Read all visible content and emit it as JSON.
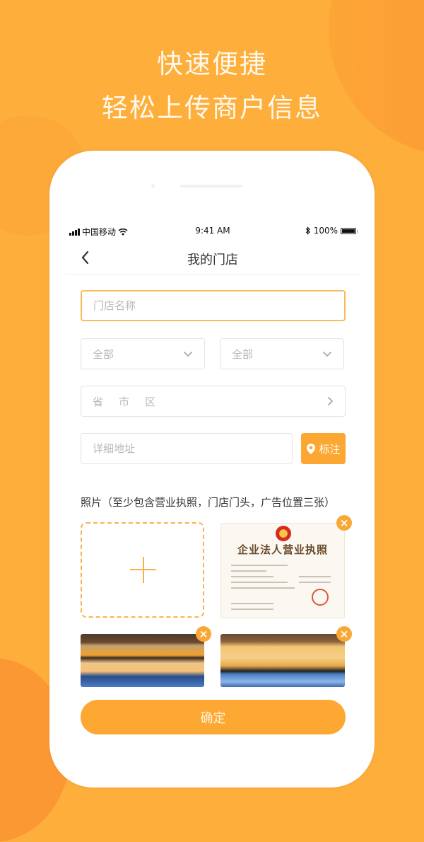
{
  "promo": {
    "headline_1": "快速便捷",
    "headline_2": "轻松上传商户信息"
  },
  "status_bar": {
    "carrier": "中国移动",
    "time": "9:41 AM",
    "battery": "100%",
    "battery_level": 1.0
  },
  "nav": {
    "title": "我的门店",
    "back_icon": "chevron-left-icon"
  },
  "form": {
    "store_name_placeholder": "门店名称",
    "store_name_value": "",
    "select_1": {
      "value": "全部",
      "icon": "chevron-down-icon"
    },
    "select_2": {
      "value": "全部",
      "icon": "chevron-down-icon"
    },
    "region": {
      "province": "省",
      "city": "市",
      "district": "区",
      "icon": "chevron-right-icon"
    },
    "address_placeholder": "详细地址",
    "address_value": "",
    "mark_button": {
      "label": "标注",
      "icon": "location-pin-icon"
    }
  },
  "photos": {
    "label": "照片（至少包含营业执照，门店门头，广告位置三张）",
    "add_icon": "plus-icon",
    "items": [
      {
        "kind": "business-license",
        "title": "企业法人营业执照",
        "remove_icon": "close-icon"
      },
      {
        "kind": "storefront",
        "remove_icon": "close-icon"
      },
      {
        "kind": "store-interior",
        "remove_icon": "close-icon"
      }
    ]
  },
  "confirm_label": "确定",
  "colors": {
    "accent": "#fda733",
    "background": "#fdae3b",
    "input_focus_border": "#f6bd5a"
  }
}
